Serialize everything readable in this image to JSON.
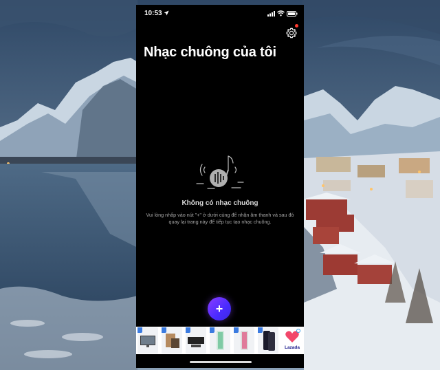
{
  "status_bar": {
    "time": "10:53"
  },
  "header": {
    "title": "Nhạc chuông của tôi",
    "settings_icon": "gear-icon",
    "badge_color": "#ff3b30"
  },
  "empty_state": {
    "title": "Không có nhạc chuông",
    "description": "Vui lòng nhấp vào nút \"+\" ở dưới cùng để nhận âm thanh và sau đó quay lại trang này để tiếp tục tạo nhạc chuông.",
    "icon": "music-note-icon"
  },
  "add_button": {
    "label": "+",
    "color": "#7b3cff"
  },
  "ad_banner": {
    "brand": "Lazada",
    "products": [
      "tv-product",
      "tv-box-product",
      "soundbar-product",
      "phone-product-1",
      "phone-product-2",
      "phone-product-3"
    ]
  }
}
